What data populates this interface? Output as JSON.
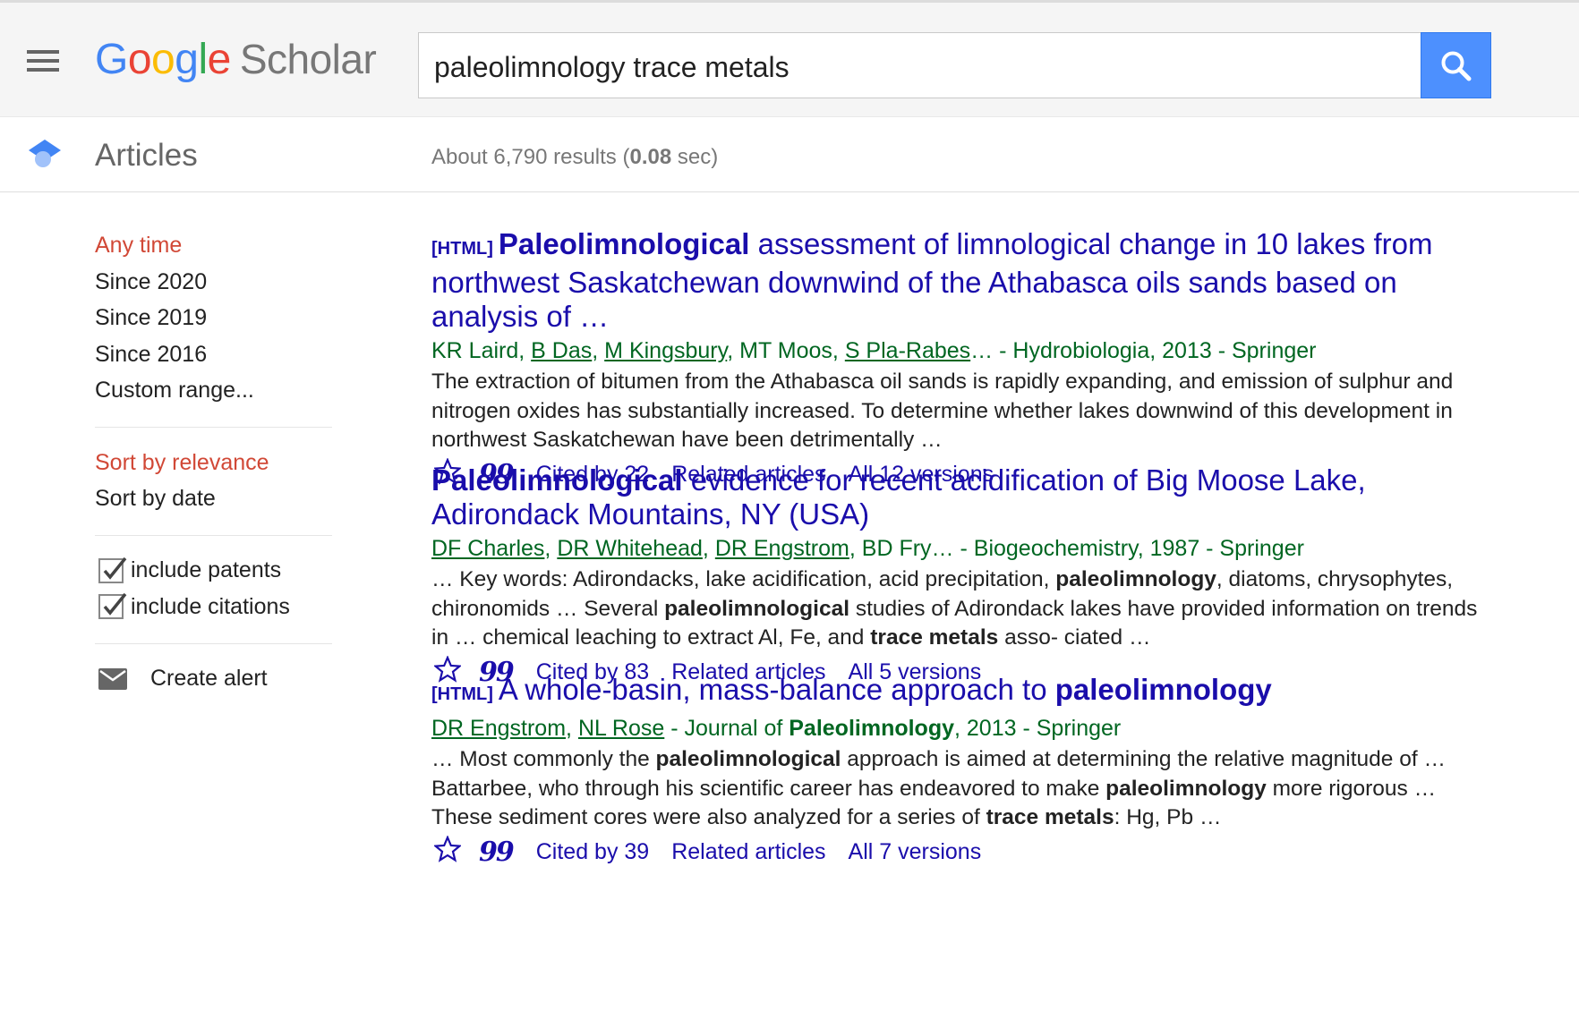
{
  "header": {
    "logo_google": [
      "G",
      "o",
      "o",
      "g",
      "l",
      "e"
    ],
    "logo_scholar": "Scholar",
    "search_value": "paleolimnology trace metals"
  },
  "subbar": {
    "section_label": "Articles",
    "stats_prefix": "About 6,790 results (",
    "stats_time": "0.08",
    "stats_suffix": " sec)"
  },
  "sidebar": {
    "time_filters": [
      "Any time",
      "Since 2020",
      "Since 2019",
      "Since 2016",
      "Custom range..."
    ],
    "sort_options": [
      "Sort by relevance",
      "Sort by date"
    ],
    "include_patents": "include patents",
    "include_citations": "include citations",
    "create_alert": "Create alert"
  },
  "colors": {
    "link": "#1a0dab",
    "green": "#006621",
    "active_red": "#d14836",
    "search_blue": "#4d90fe"
  },
  "results": [
    {
      "tag": "[HTML]",
      "title_bold": "Paleolimnological",
      "title_rest": " assessment of limnological change in 10 lakes from northwest Saskatchewan downwind of the Athabasca oils sands based on analysis of …",
      "authors": [
        "KR Laird",
        "B Das",
        "M Kingsbury",
        "MT Moos",
        "S Pla-Rabes"
      ],
      "source": "… - Hydrobiologia, 2013 - Springer",
      "snippet": "The extraction of bitumen from the Athabasca oil sands is rapidly expanding, and emission of sulphur and nitrogen oxides has substantially increased. To determine whether lakes downwind of this development in northwest Saskatchewan have been detrimentally …",
      "cited_by": "Cited by 22",
      "related": "Related articles",
      "versions": "All 12 versions"
    },
    {
      "tag": "",
      "title_bold": "Paleolimnological",
      "title_rest": " evidence for recent acidification of Big Moose Lake, Adirondack Mountains, NY (USA)",
      "authors": [
        "DF Charles",
        "DR Whitehead",
        "DR Engstrom",
        "BD Fry"
      ],
      "source": "… - Biogeochemistry, 1987 - Springer",
      "snippet_parts": [
        {
          "t": "… Key words: Adirondacks, lake acidification, acid precipitation, ",
          "b": false
        },
        {
          "t": "paleolimnology",
          "b": true
        },
        {
          "t": ", diatoms, chrysophytes, chironomids … Several ",
          "b": false
        },
        {
          "t": "paleolimnological",
          "b": true
        },
        {
          "t": " studies of Adirondack lakes have provided information on trends in … chemical leaching to extract Al, Fe, and ",
          "b": false
        },
        {
          "t": "trace metals",
          "b": true
        },
        {
          "t": " asso- ciated …",
          "b": false
        }
      ],
      "cited_by": "Cited by 83",
      "related": "Related articles",
      "versions": "All 5 versions"
    },
    {
      "tag": "[HTML]",
      "title_plain": "A whole-basin, mass-balance approach to ",
      "title_bold_end": "paleolimnology",
      "authors": [
        "DR Engstrom",
        "NL Rose"
      ],
      "source_prefix": " - Journal of ",
      "source_bold": "Paleolimnology",
      "source_suffix": ", 2013 - Springer",
      "snippet_parts": [
        {
          "t": "… Most commonly the ",
          "b": false
        },
        {
          "t": "paleolimnological",
          "b": true
        },
        {
          "t": " approach is aimed at determining the relative magnitude of … Battarbee, who through his scientific career has endeavored to make ",
          "b": false
        },
        {
          "t": "paleolimnology",
          "b": true
        },
        {
          "t": " more rigorous … These sediment cores were also analyzed for a series of ",
          "b": false
        },
        {
          "t": "trace metals",
          "b": true
        },
        {
          "t": ": Hg, Pb …",
          "b": false
        }
      ],
      "cited_by": "Cited by 39",
      "related": "Related articles",
      "versions": "All 7 versions"
    }
  ]
}
